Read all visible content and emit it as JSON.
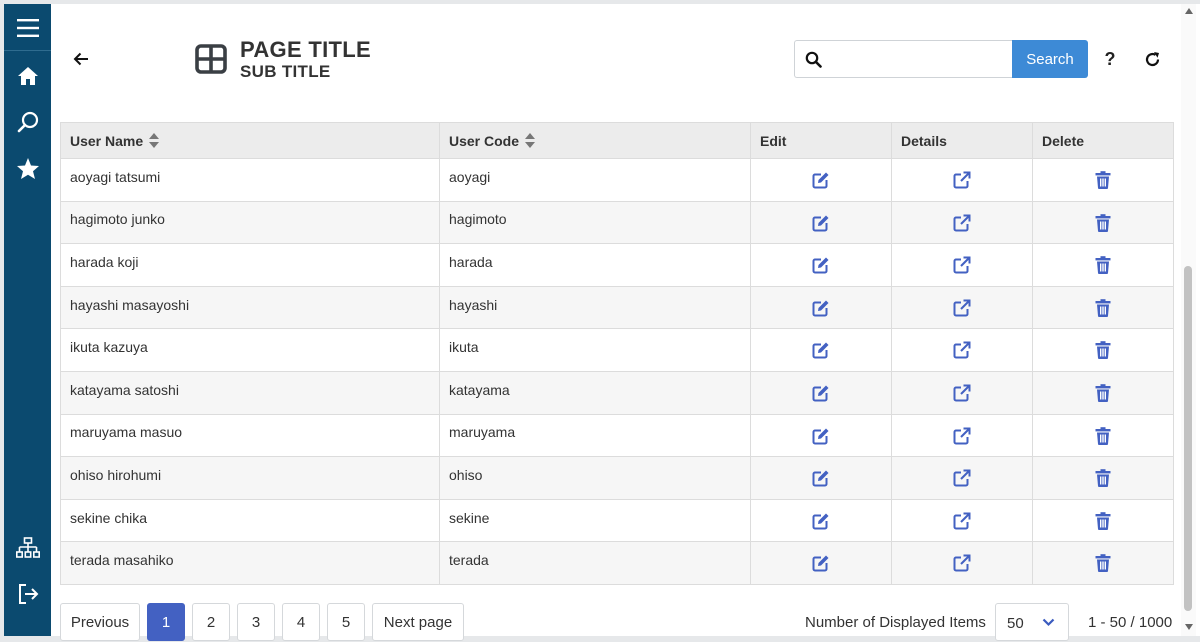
{
  "header": {
    "page_title": "PAGE TITLE",
    "sub_title": "SUB TITLE",
    "search_placeholder": "",
    "search_button": "Search",
    "help_label": "?"
  },
  "sidebar": {
    "items": [
      {
        "name": "menu",
        "icon": "hamburger-menu-icon"
      },
      {
        "name": "home",
        "icon": "home-icon"
      },
      {
        "name": "search",
        "icon": "search-icon"
      },
      {
        "name": "favorites",
        "icon": "star-icon"
      },
      {
        "name": "sitemap",
        "icon": "sitemap-icon"
      },
      {
        "name": "logout",
        "icon": "logout-icon"
      }
    ]
  },
  "table": {
    "columns": [
      "User Name",
      "User Code",
      "Edit",
      "Details",
      "Delete"
    ],
    "rows": [
      {
        "user_name": "aoyagi tatsumi",
        "user_code": "aoyagi"
      },
      {
        "user_name": "hagimoto junko",
        "user_code": "hagimoto"
      },
      {
        "user_name": "harada koji",
        "user_code": "harada"
      },
      {
        "user_name": "hayashi masayoshi",
        "user_code": "hayashi"
      },
      {
        "user_name": "ikuta kazuya",
        "user_code": "ikuta"
      },
      {
        "user_name": "katayama satoshi",
        "user_code": "katayama"
      },
      {
        "user_name": "maruyama masuo",
        "user_code": "maruyama"
      },
      {
        "user_name": "ohiso hirohumi",
        "user_code": "ohiso"
      },
      {
        "user_name": "sekine chika",
        "user_code": "sekine"
      },
      {
        "user_name": "terada masahiko",
        "user_code": "terada"
      }
    ]
  },
  "pagination": {
    "previous_label": "Previous",
    "pages": [
      "1",
      "2",
      "3",
      "4",
      "5"
    ],
    "active_page": "1",
    "next_label": "Next page",
    "items_label": "Number of Displayed Items",
    "items_per_page": "50",
    "range_text": "1 - 50 / 1000"
  },
  "colors": {
    "sidebar_bg": "#0b4a6f",
    "accent": "#3d8ad6",
    "action_icon": "#4361c2",
    "active_page": "#4361c2"
  }
}
